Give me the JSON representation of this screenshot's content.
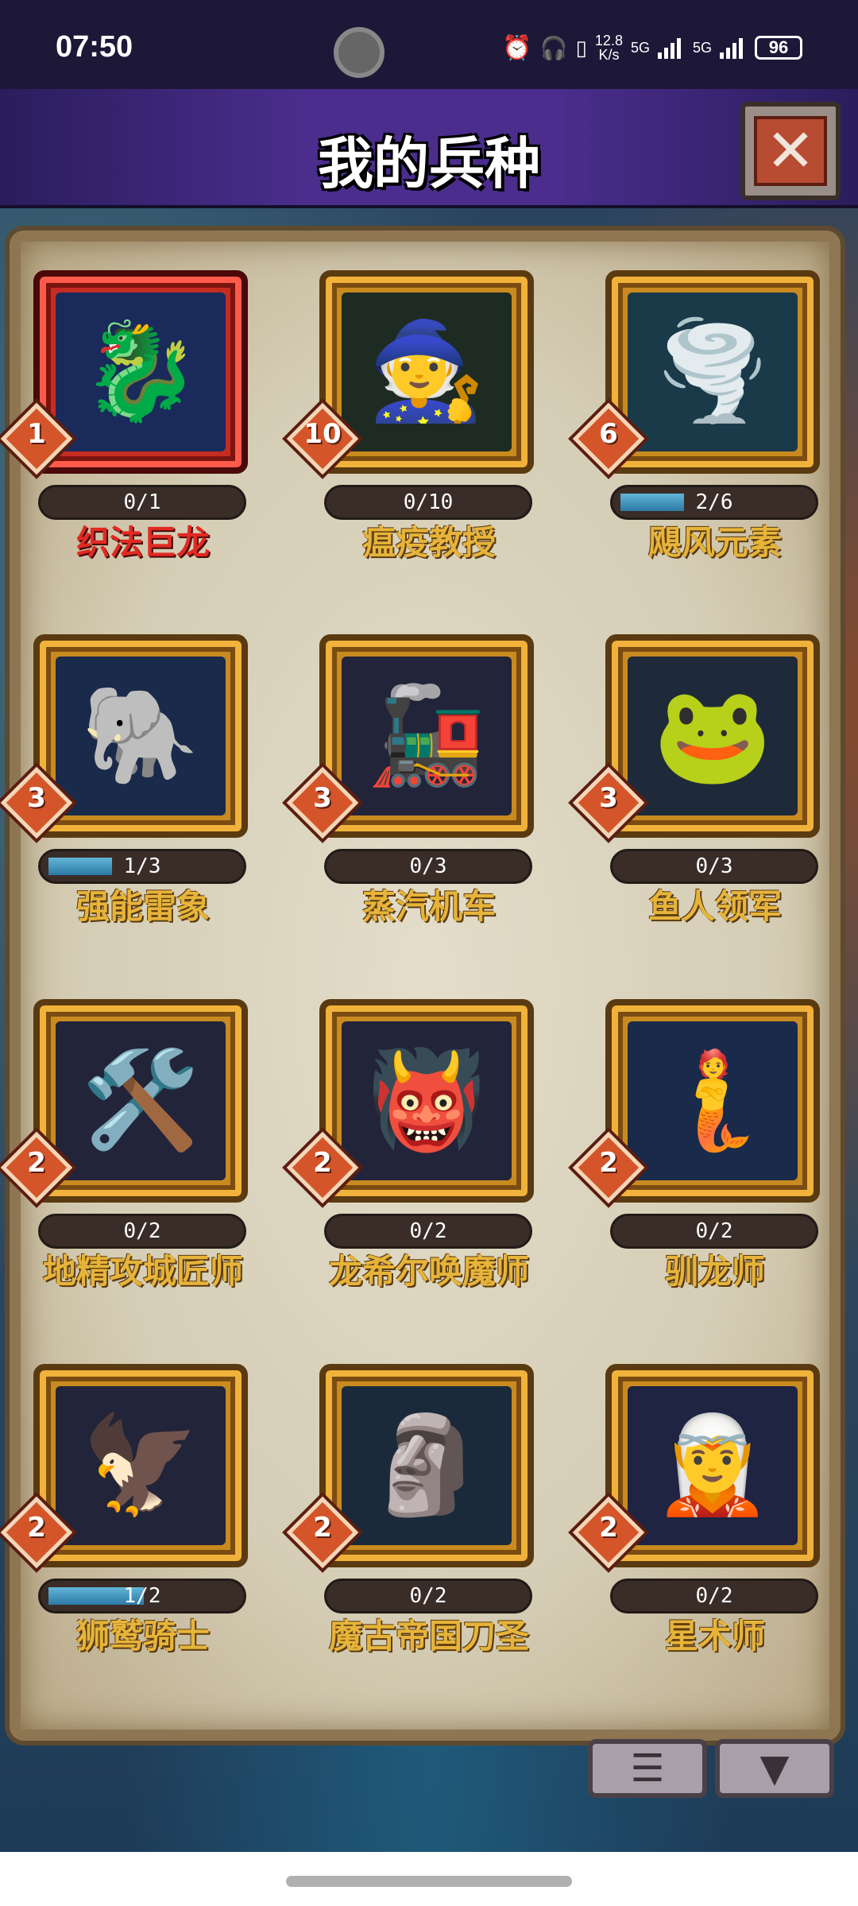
{
  "status_bar": {
    "time": "07:50",
    "speed": "12.8",
    "speed_unit": "K/s",
    "net1": "5G",
    "net2": "5G",
    "battery": "96",
    "icons": [
      "alarm-icon",
      "headphones-icon",
      "vibrate-icon"
    ]
  },
  "header": {
    "title": "我的兵种",
    "close_icon": "close-icon"
  },
  "units": [
    {
      "name": "织法巨龙",
      "level": "1",
      "progress_text": "0/1",
      "progress": 0,
      "selected": true,
      "icon": "🐉",
      "bg": "#1a2a5a"
    },
    {
      "name": "瘟疫教授",
      "level": "10",
      "progress_text": "0/10",
      "progress": 0,
      "selected": false,
      "icon": "🧙",
      "bg": "#1e2b22"
    },
    {
      "name": "飓风元素",
      "level": "6",
      "progress_text": "2/6",
      "progress": 0.333,
      "selected": false,
      "icon": "🌪️",
      "bg": "#1a3a4a"
    },
    {
      "name": "强能雷象",
      "level": "3",
      "progress_text": "1/3",
      "progress": 0.333,
      "selected": false,
      "icon": "🐘",
      "bg": "#1a2a4a"
    },
    {
      "name": "蒸汽机车",
      "level": "3",
      "progress_text": "0/3",
      "progress": 0,
      "selected": false,
      "icon": "🚂",
      "bg": "#22243a"
    },
    {
      "name": "鱼人领军",
      "level": "3",
      "progress_text": "0/3",
      "progress": 0,
      "selected": false,
      "icon": "🐸",
      "bg": "#1e2a3a"
    },
    {
      "name": "地精攻城匠师",
      "level": "2",
      "progress_text": "0/2",
      "progress": 0,
      "selected": false,
      "icon": "🛠️",
      "bg": "#22243a"
    },
    {
      "name": "龙希尔唤魔师",
      "level": "2",
      "progress_text": "0/2",
      "progress": 0,
      "selected": false,
      "icon": "👹",
      "bg": "#22243a"
    },
    {
      "name": "驯龙师",
      "level": "2",
      "progress_text": "0/2",
      "progress": 0,
      "selected": false,
      "icon": "🧜",
      "bg": "#1a2a4a"
    },
    {
      "name": "狮鹫骑士",
      "level": "2",
      "progress_text": "1/2",
      "progress": 0.5,
      "selected": false,
      "icon": "🦅",
      "bg": "#22243a"
    },
    {
      "name": "魔古帝国刀圣",
      "level": "2",
      "progress_text": "0/2",
      "progress": 0,
      "selected": false,
      "icon": "🗿",
      "bg": "#1a2a3a"
    },
    {
      "name": "星术师",
      "level": "2",
      "progress_text": "0/2",
      "progress": 0,
      "selected": false,
      "icon": "🧝",
      "bg": "#1e2442"
    }
  ],
  "bottom": {
    "list_icon": "list-icon",
    "filter_icon": "filter-icon",
    "list_glyph": "☰",
    "filter_glyph": "▼"
  }
}
